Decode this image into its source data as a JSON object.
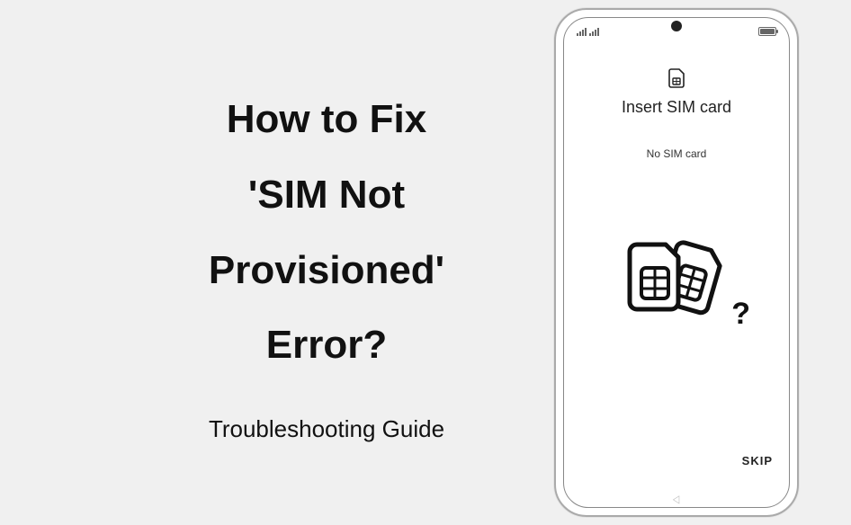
{
  "text": {
    "headline_line1": "How to Fix",
    "headline_line2": "'SIM Not Provisioned'",
    "headline_line3": "Error?",
    "subtitle": "Troubleshooting Guide"
  },
  "phone": {
    "screen_title": "Insert SIM card",
    "screen_message": "No SIM card",
    "skip_label": "SKIP",
    "question_mark": "?"
  }
}
